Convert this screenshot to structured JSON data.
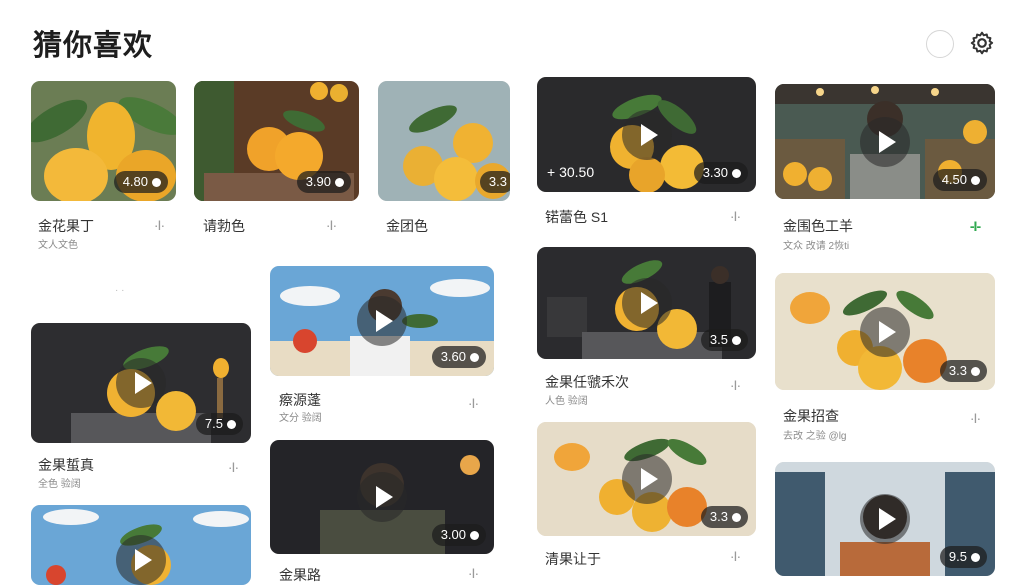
{
  "header": {
    "title": "猜你喜欢",
    "profile_icon": "circle-outline-icon",
    "settings_icon": "gear-icon"
  },
  "ellipsis": "· ·",
  "videos": [
    {
      "title": "金花果丁",
      "sub": "文人文色",
      "duration": "4.80",
      "menu": "·I·"
    },
    {
      "title": "请勃色",
      "sub": "",
      "duration": "3.90",
      "menu": "·I·"
    },
    {
      "title": "金团色",
      "sub": "",
      "duration": "3.3",
      "menu": ""
    },
    {
      "title": "锘蕾色 S1",
      "sub": "",
      "duration": "3.30",
      "views": "+ 30.50",
      "menu": "·I·"
    },
    {
      "title": "金围色工羊",
      "sub": "文众 改请 2恢ti",
      "duration": "4.50",
      "menu": "-I-"
    },
    {
      "title": "金果蜇真",
      "sub": "全色 验阔",
      "duration": "7.5",
      "menu": "·I·"
    },
    {
      "title": "瘵源蓬",
      "sub": "文分 验阔",
      "duration": "3.60",
      "menu": "·I·"
    },
    {
      "title": "金果路",
      "sub": "",
      "duration": "3.00",
      "menu": "·I·"
    },
    {
      "title": "金果任虢禾次",
      "sub": "人色 验阔",
      "duration": "3.5",
      "menu": "·I·"
    },
    {
      "title": "金果招查",
      "sub": "去改 之验 @lg",
      "duration": "3.3",
      "menu": "·I·"
    },
    {
      "title": "清果让于",
      "sub": "",
      "duration": "3.3",
      "menu": "·I·"
    },
    {
      "title": "",
      "sub": "",
      "duration": "",
      "menu": ""
    },
    {
      "title": "",
      "sub": "",
      "duration": "9.5",
      "menu": ""
    }
  ],
  "colors": {
    "accent_menu": "#2fa84f",
    "badge_bg": "#1c1c1c"
  }
}
